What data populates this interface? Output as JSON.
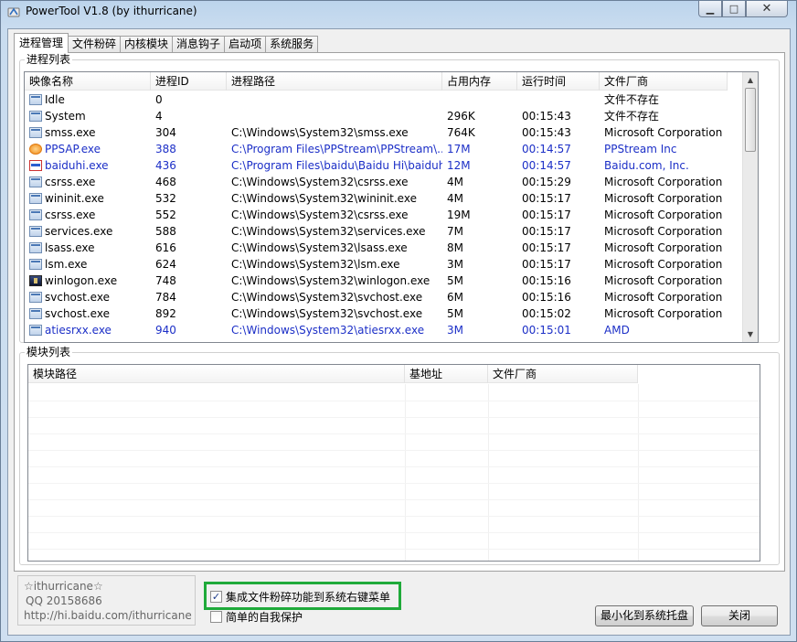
{
  "window": {
    "title": "PowerTool V1.8 (by ithurricane)",
    "min_glyph": "▁",
    "max_glyph": "□",
    "close_glyph": "✕"
  },
  "tabs": [
    "进程管理",
    "文件粉碎",
    "内核模块",
    "消息钩子",
    "启动项",
    "系统服务"
  ],
  "process_list": {
    "label": "进程列表",
    "columns": [
      "映像名称",
      "进程ID",
      "进程路径",
      "占用内存",
      "运行时间",
      "文件厂商"
    ],
    "rows": [
      {
        "icon": "generic",
        "blue": false,
        "cells": [
          "Idle",
          "0",
          "",
          "",
          "",
          "文件不存在"
        ]
      },
      {
        "icon": "generic",
        "blue": false,
        "cells": [
          "System",
          "4",
          "",
          "296K",
          "00:15:43",
          "文件不存在"
        ]
      },
      {
        "icon": "generic",
        "blue": false,
        "cells": [
          "smss.exe",
          "304",
          "C:\\Windows\\System32\\smss.exe",
          "764K",
          "00:15:43",
          "Microsoft Corporation"
        ]
      },
      {
        "icon": "pps",
        "blue": true,
        "cells": [
          "PPSAP.exe",
          "388",
          "C:\\Program Files\\PPStream\\PPStream\\...",
          "17M",
          "00:14:57",
          "PPStream Inc"
        ]
      },
      {
        "icon": "hi",
        "blue": true,
        "cells": [
          "baiduhi.exe",
          "436",
          "C:\\Program Files\\baidu\\Baidu Hi\\baiduh...",
          "12M",
          "00:14:57",
          "Baidu.com, Inc."
        ]
      },
      {
        "icon": "generic",
        "blue": false,
        "cells": [
          "csrss.exe",
          "468",
          "C:\\Windows\\System32\\csrss.exe",
          "4M",
          "00:15:29",
          "Microsoft Corporation"
        ]
      },
      {
        "icon": "generic",
        "blue": false,
        "cells": [
          "wininit.exe",
          "532",
          "C:\\Windows\\System32\\wininit.exe",
          "4M",
          "00:15:17",
          "Microsoft Corporation"
        ]
      },
      {
        "icon": "generic",
        "blue": false,
        "cells": [
          "csrss.exe",
          "552",
          "C:\\Windows\\System32\\csrss.exe",
          "19M",
          "00:15:17",
          "Microsoft Corporation"
        ]
      },
      {
        "icon": "generic",
        "blue": false,
        "cells": [
          "services.exe",
          "588",
          "C:\\Windows\\System32\\services.exe",
          "7M",
          "00:15:17",
          "Microsoft Corporation"
        ]
      },
      {
        "icon": "generic",
        "blue": false,
        "cells": [
          "lsass.exe",
          "616",
          "C:\\Windows\\System32\\lsass.exe",
          "8M",
          "00:15:17",
          "Microsoft Corporation"
        ]
      },
      {
        "icon": "generic",
        "blue": false,
        "cells": [
          "lsm.exe",
          "624",
          "C:\\Windows\\System32\\lsm.exe",
          "3M",
          "00:15:17",
          "Microsoft Corporation"
        ]
      },
      {
        "icon": "winlogon",
        "blue": false,
        "cells": [
          "winlogon.exe",
          "748",
          "C:\\Windows\\System32\\winlogon.exe",
          "5M",
          "00:15:16",
          "Microsoft Corporation"
        ]
      },
      {
        "icon": "generic",
        "blue": false,
        "cells": [
          "svchost.exe",
          "784",
          "C:\\Windows\\System32\\svchost.exe",
          "6M",
          "00:15:16",
          "Microsoft Corporation"
        ]
      },
      {
        "icon": "generic",
        "blue": false,
        "cells": [
          "svchost.exe",
          "892",
          "C:\\Windows\\System32\\svchost.exe",
          "5M",
          "00:15:02",
          "Microsoft Corporation"
        ]
      },
      {
        "icon": "generic",
        "blue": true,
        "cells": [
          "atiesrxx.exe",
          "940",
          "C:\\Windows\\System32\\atiesrxx.exe",
          "3M",
          "00:15:01",
          "AMD"
        ]
      }
    ]
  },
  "module_list": {
    "label": "模块列表",
    "columns": [
      "模块路径",
      "基地址",
      "文件厂商"
    ]
  },
  "info": {
    "line1": "☆ithurricane☆",
    "line2": "QQ 20158686",
    "line3": "http://hi.baidu.com/ithurricane"
  },
  "options": {
    "shell_menu": {
      "label": "集成文件粉碎功能到系统右键菜单",
      "checked": true,
      "mark": "✓"
    },
    "self_protect": {
      "label": "简单的自我保护",
      "checked": false,
      "mark": ""
    }
  },
  "buttons": {
    "tray": "最小化到系统托盘",
    "close": "关闭"
  },
  "scroll": {
    "up": "▲",
    "down": "▼"
  }
}
